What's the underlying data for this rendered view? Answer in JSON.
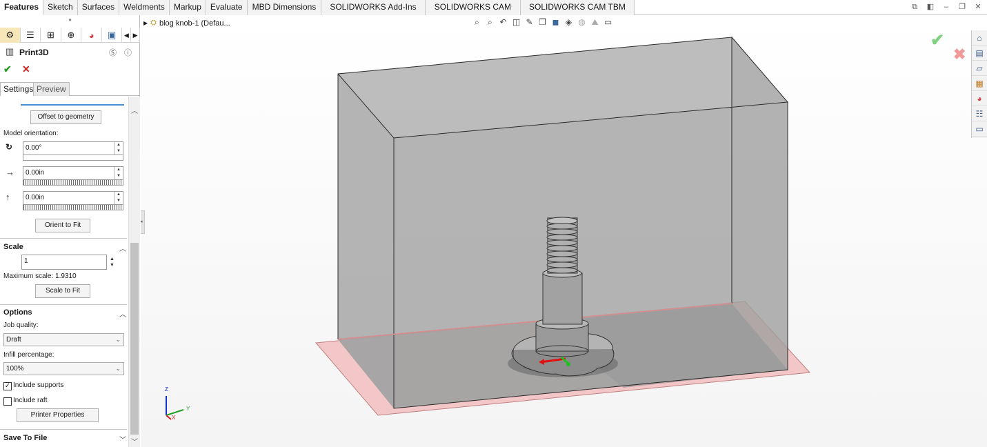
{
  "ribbon": {
    "tabs": [
      "Features",
      "Sketch",
      "Surfaces",
      "Weldments",
      "Markup",
      "Evaluate",
      "MBD Dimensions",
      "SOLIDWORKS Add-Ins",
      "SOLIDWORKS CAM",
      "SOLIDWORKS CAM TBM"
    ],
    "active_tab": "Features"
  },
  "property_manager": {
    "title": "Print3D",
    "subtabs": {
      "settings": "Settings",
      "preview": "Preview"
    },
    "offset_button": "Offset to geometry",
    "model_orientation_label": "Model orientation:",
    "rotation_value": "0.00°",
    "x_offset_value": "0.00in",
    "y_offset_value": "0.00in",
    "orient_button": "Orient to Fit",
    "scale": {
      "heading": "Scale",
      "value": "1",
      "max_label": "Maximum scale: 1.9310",
      "fit_button": "Scale to Fit"
    },
    "options": {
      "heading": "Options",
      "job_quality_label": "Job quality:",
      "job_quality_value": "Draft",
      "infill_label": "Infill percentage:",
      "infill_value": "100%",
      "include_supports_label": "Include supports",
      "include_supports_checked": true,
      "include_raft_label": "Include raft",
      "include_raft_checked": false,
      "printer_button": "Printer Properties"
    },
    "save_heading": "Save To File"
  },
  "graphics": {
    "tree_label": "blog knob-1  (Defau...",
    "triad": {
      "z": "Z",
      "y": "Y",
      "x": "X"
    }
  },
  "colors": {
    "accept": "#7fd07f",
    "reject": "#f09a9a",
    "build_plate": "#f2c4c4",
    "build_volume": "#a8a8a8"
  }
}
